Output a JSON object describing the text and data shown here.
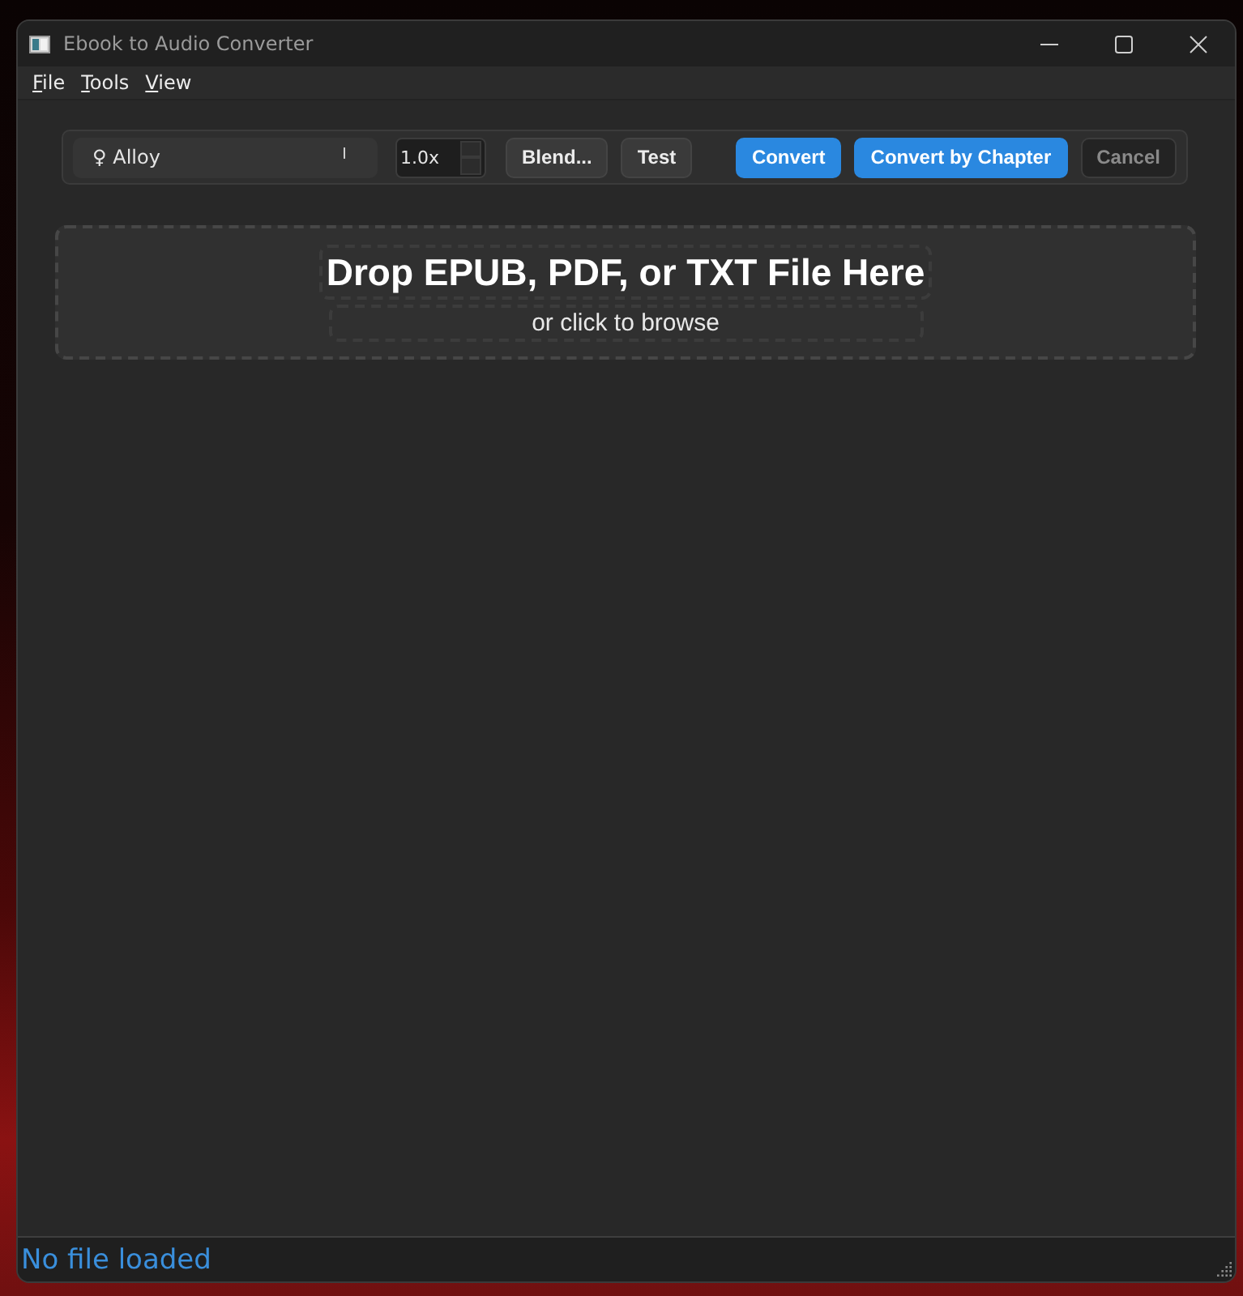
{
  "window": {
    "title": "Ebook to Audio Converter"
  },
  "menu": [
    {
      "label": "File"
    },
    {
      "label": "Tools"
    },
    {
      "label": "View"
    }
  ],
  "toolbar": {
    "voice": {
      "value": "♀ Alloy"
    },
    "speed": {
      "value": "1.0x"
    },
    "buttons": [
      {
        "label": "Blend...",
        "kind": "secondary",
        "disabled": false
      },
      {
        "label": "Test",
        "kind": "secondary",
        "disabled": false
      },
      {
        "label": "Convert",
        "kind": "primary",
        "disabled": false
      },
      {
        "label": "Convert by Chapter",
        "kind": "primary",
        "disabled": false
      },
      {
        "label": "Cancel",
        "kind": "secondary",
        "disabled": true
      }
    ]
  },
  "drop_zone": {
    "title": "Drop EPUB, PDF, or TXT File Here",
    "subtitle": "or click to browse"
  },
  "status_bar": {
    "text": "No file loaded"
  }
}
